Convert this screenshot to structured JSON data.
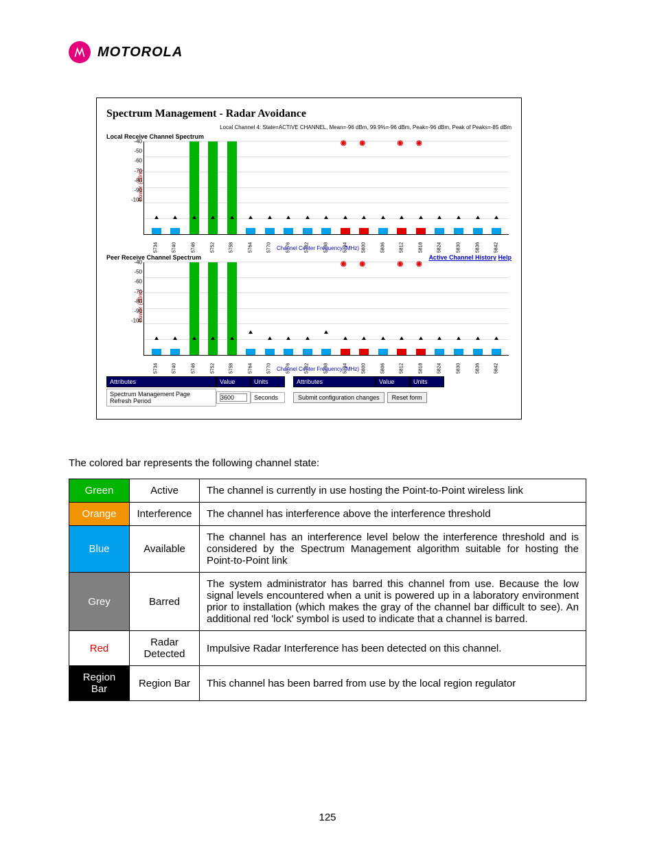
{
  "brand": {
    "name": "MOTOROLA"
  },
  "figure": {
    "title": "Spectrum Management - Radar Avoidance",
    "status_line": "Local Channel 4: State=ACTIVE CHANNEL, Mean=-96 dBm, 99.9%=-96 dBm, Peak=-96 dBm, Peak of Peaks=-85 dBm",
    "local_heading": "Local Receive Channel Spectrum",
    "peer_heading": "Peer Receive Channel Spectrum",
    "link_history": "Active Channel History",
    "link_help": "Help",
    "ylabel": "Power (dBm)",
    "xlabel": "Channel Center Frequency (MHz)",
    "attrs_header": {
      "attributes": "Attributes",
      "value": "Value",
      "units": "Units"
    },
    "attrs_row": {
      "label": "Spectrum Management Page Refresh Period",
      "value": "3600",
      "units": "Seconds"
    },
    "buttons": {
      "submit": "Submit configuration changes",
      "reset": "Reset form"
    }
  },
  "chart_data": [
    {
      "type": "bar",
      "title": "Local Receive Channel Spectrum",
      "xlabel": "Channel Center Frequency (MHz)",
      "ylabel": "Power (dBm)",
      "ylim": [
        -100,
        -40
      ],
      "yticks": [
        -40,
        -50,
        -60,
        -70,
        -80,
        -90,
        -100
      ],
      "categories": [
        5734,
        5740,
        5746,
        5752,
        5758,
        5764,
        5770,
        5776,
        5782,
        5788,
        5794,
        5800,
        5806,
        5812,
        5818,
        5824,
        5830,
        5836,
        5842
      ],
      "series": [
        {
          "name": "power_dBm",
          "values": [
            -96,
            -96,
            -40,
            -40,
            -40,
            -96,
            -96,
            -96,
            -96,
            -96,
            -96,
            -96,
            -96,
            -96,
            -96,
            -96,
            -96,
            -96,
            -96
          ]
        }
      ],
      "bar_state": [
        "blue",
        "blue",
        "green",
        "green",
        "green",
        "blue",
        "blue",
        "blue",
        "blue",
        "blue",
        "red",
        "red",
        "blue",
        "red",
        "red",
        "blue",
        "blue",
        "blue",
        "blue"
      ],
      "peak_marker_dBm": [
        -90,
        -90,
        -90,
        -90,
        -90,
        -90,
        -90,
        -90,
        -90,
        -90,
        -90,
        -90,
        -90,
        -90,
        -90,
        -90,
        -90,
        -90,
        -90
      ]
    },
    {
      "type": "bar",
      "title": "Peer Receive Channel Spectrum",
      "xlabel": "Channel Center Frequency (MHz)",
      "ylabel": "Power (dBm)",
      "ylim": [
        -100,
        -40
      ],
      "yticks": [
        -40,
        -50,
        -60,
        -70,
        -80,
        -90,
        -100
      ],
      "categories": [
        5734,
        5740,
        5746,
        5752,
        5758,
        5764,
        5770,
        5776,
        5782,
        5788,
        5794,
        5800,
        5806,
        5812,
        5818,
        5824,
        5830,
        5836,
        5842
      ],
      "series": [
        {
          "name": "power_dBm",
          "values": [
            -96,
            -96,
            -40,
            -40,
            -40,
            -96,
            -96,
            -96,
            -96,
            -96,
            -96,
            -96,
            -96,
            -96,
            -96,
            -96,
            -96,
            -96,
            -96
          ]
        }
      ],
      "bar_state": [
        "blue",
        "blue",
        "green",
        "green",
        "green",
        "blue",
        "blue",
        "blue",
        "blue",
        "blue",
        "red",
        "red",
        "blue",
        "red",
        "red",
        "blue",
        "blue",
        "blue",
        "blue"
      ],
      "peak_marker_dBm": [
        -90,
        -90,
        -90,
        -90,
        -90,
        -86,
        -90,
        -90,
        -90,
        -86,
        -90,
        -90,
        -90,
        -90,
        -90,
        -90,
        -90,
        -90,
        -90
      ]
    }
  ],
  "intro_text": "The colored bar represents the following channel state:",
  "state_rows": [
    {
      "color_label": "Green",
      "color_class": "c-green",
      "state": "Active",
      "desc": "The channel is currently in use hosting the Point-to-Point wireless link"
    },
    {
      "color_label": "Orange",
      "color_class": "c-orange",
      "state": "Interference",
      "desc": "The channel has interference above the interference threshold"
    },
    {
      "color_label": "Blue",
      "color_class": "c-blue",
      "state": "Available",
      "desc": "The channel has an interference level below the interference threshold and is considered by the Spectrum Management algorithm suitable for hosting the Point-to-Point link"
    },
    {
      "color_label": "Grey",
      "color_class": "c-grey",
      "state": "Barred",
      "desc": "The system administrator has barred this channel from use. Because the low signal levels encountered when a unit is powered up in a laboratory environment prior to installation (which makes the gray of the channel bar difficult to see). An additional red 'lock' symbol is used to indicate that a channel is barred."
    },
    {
      "color_label": "Red",
      "color_class": "c-red",
      "state": "Radar Detected",
      "desc": "Impulsive Radar Interference has been detected on this channel."
    },
    {
      "color_label": "Region Bar",
      "color_class": "c-region",
      "state": "Region Bar",
      "desc": "This channel has been barred from use by the local region regulator"
    }
  ],
  "page_number": "125"
}
